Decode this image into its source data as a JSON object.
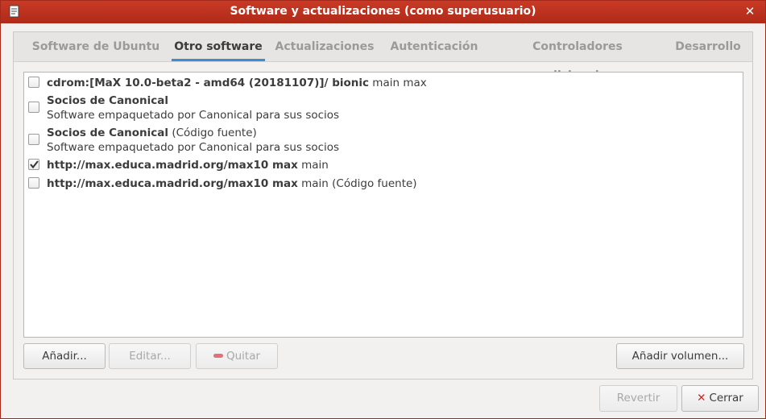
{
  "window": {
    "title": "Software y actualizaciones (como superusuario)",
    "close_icon": "close-icon",
    "app_icon": "software-properties-icon"
  },
  "tabs": [
    {
      "label": "Software de Ubuntu",
      "active": false
    },
    {
      "label": "Otro software",
      "active": true
    },
    {
      "label": "Actualizaciones",
      "active": false
    },
    {
      "label": "Autenticación",
      "active": false
    },
    {
      "label": "Controladores adicionales",
      "active": false
    },
    {
      "label": "Desarrollo",
      "active": false
    }
  ],
  "sources": [
    {
      "checked": false,
      "bold": "cdrom:[MaX 10.0-beta2 - amd64 (20181107)]/ bionic",
      "rest": " main max",
      "sub": ""
    },
    {
      "checked": false,
      "bold": "Socios de Canonical",
      "rest": "",
      "sub": "Software empaquetado por Canonical para sus socios"
    },
    {
      "checked": false,
      "bold": "Socios de Canonical",
      "rest": " (Código fuente)",
      "sub": "Software empaquetado por Canonical para sus socios"
    },
    {
      "checked": true,
      "bold": "http://max.educa.madrid.org/max10 max",
      "rest": " main",
      "sub": ""
    },
    {
      "checked": false,
      "bold": "http://max.educa.madrid.org/max10 max",
      "rest": " main (Código fuente)",
      "sub": ""
    }
  ],
  "buttons": {
    "add": "Añadir...",
    "edit": "Editar...",
    "remove": "Quitar",
    "add_volume": "Añadir volumen...",
    "revert": "Revertir",
    "close": "Cerrar"
  },
  "colors": {
    "titlebar": "#c83a26",
    "active_tab_underline": "#3c8cd6",
    "close_icon": "#d0271a"
  }
}
